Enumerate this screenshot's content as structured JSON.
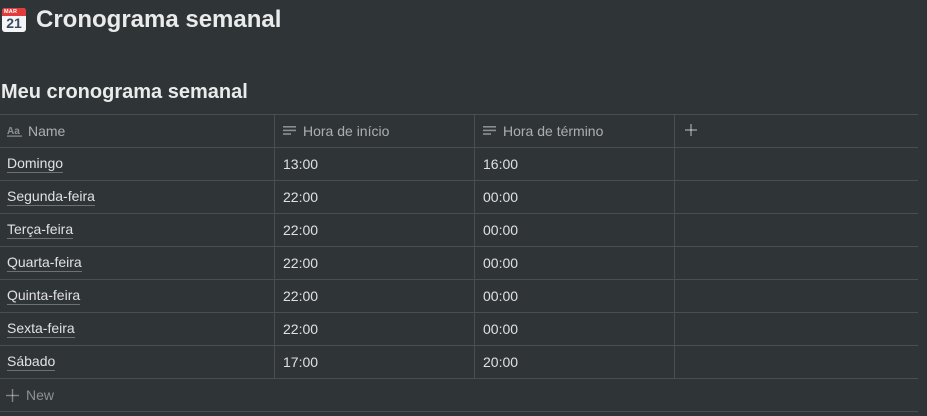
{
  "page": {
    "title": "Cronograma semanal",
    "icon": {
      "name": "calendar-icon",
      "month": "MAR",
      "day": "21"
    }
  },
  "database": {
    "title": "Meu cronograma semanal",
    "columns": [
      {
        "label": "Name",
        "icon": "text-title-icon"
      },
      {
        "label": "Hora de início",
        "icon": "text-lines-icon"
      },
      {
        "label": "Hora de término",
        "icon": "text-lines-icon"
      }
    ],
    "add_column_icon": "plus-icon",
    "rows": [
      {
        "name": "Domingo",
        "start": "13:00",
        "end": "16:00"
      },
      {
        "name": "Segunda-feira",
        "start": "22:00",
        "end": "00:00"
      },
      {
        "name": "Terça-feira",
        "start": "22:00",
        "end": "00:00"
      },
      {
        "name": "Quarta-feira",
        "start": "22:00",
        "end": "00:00"
      },
      {
        "name": "Quinta-feira",
        "start": "22:00",
        "end": "00:00"
      },
      {
        "name": "Sexta-feira",
        "start": "22:00",
        "end": "00:00"
      },
      {
        "name": "Sábado",
        "start": "17:00",
        "end": "20:00"
      }
    ],
    "new_label": "New"
  },
  "colors": {
    "background": "#2f3437",
    "calendar_red": "#e23b3b"
  }
}
